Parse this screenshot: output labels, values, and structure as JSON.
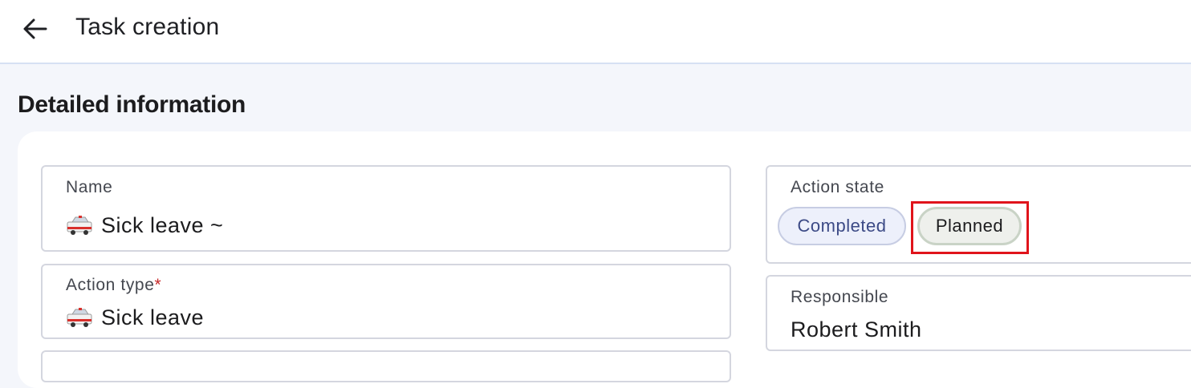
{
  "header": {
    "back_icon": "arrow-left-icon",
    "title": "Task creation"
  },
  "section": {
    "title": "Detailed information"
  },
  "form": {
    "name": {
      "label": "Name",
      "icon": "ambulance-icon",
      "value": "Sick leave ~"
    },
    "action_type": {
      "label": "Action type",
      "required_mark": "*",
      "icon": "ambulance-icon",
      "value": "Sick leave"
    },
    "action_state": {
      "label": "Action state",
      "options": [
        "Completed",
        "Planned"
      ],
      "selected": "Planned"
    },
    "responsible": {
      "label": "Responsible",
      "value": "Robert Smith"
    }
  },
  "colors": {
    "highlight": "#e0141b",
    "completed_chip_text": "#3c4a86",
    "header_divider": "#d6e0f3"
  }
}
